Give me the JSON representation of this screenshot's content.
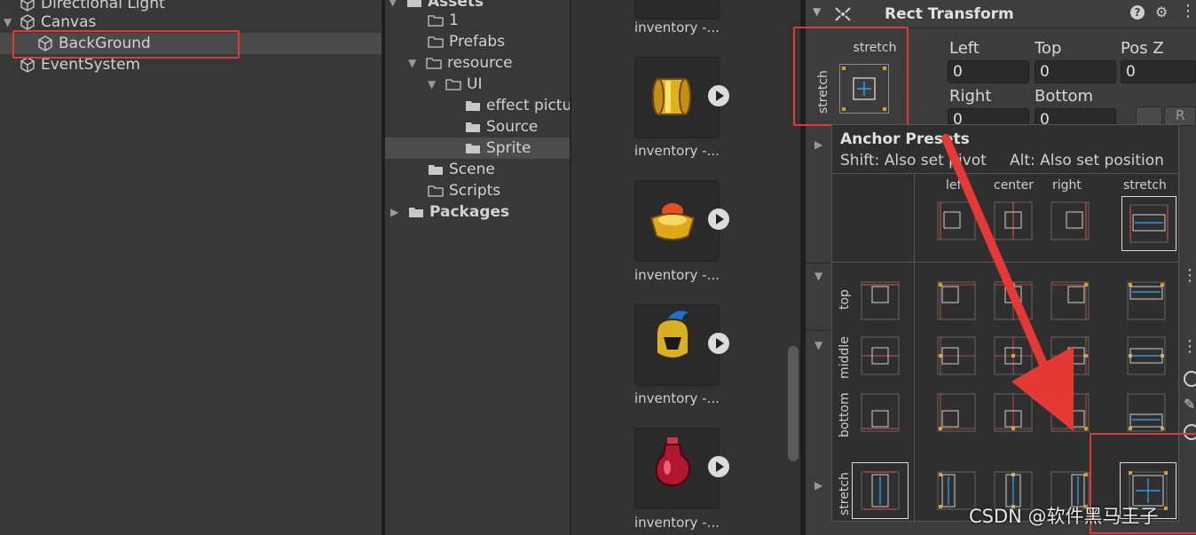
{
  "hierarchy": {
    "items": [
      {
        "label": "Directional Light",
        "expanded": false
      },
      {
        "label": "Canvas",
        "expanded": true
      },
      {
        "label": "BackGround",
        "selected": true
      },
      {
        "label": "EventSystem"
      }
    ]
  },
  "project": {
    "items": [
      {
        "label": "Assets",
        "bold": true
      },
      {
        "label": "1"
      },
      {
        "label": "Prefabs"
      },
      {
        "label": "resource"
      },
      {
        "label": "UI"
      },
      {
        "label": "effect pictu"
      },
      {
        "label": "Source"
      },
      {
        "label": "Sprite",
        "selected": true
      },
      {
        "label": "Scene"
      },
      {
        "label": "Scripts"
      },
      {
        "label": "Packages",
        "bold": true
      }
    ]
  },
  "assets": {
    "label": "inventory -..."
  },
  "inspector": {
    "component_title": "Rect Transform",
    "anchor_horizontal": "stretch",
    "anchor_vertical": "stretch",
    "fields": {
      "left_label": "Left",
      "left_value": "0",
      "top_label": "Top",
      "top_value": "0",
      "posz_label": "Pos Z",
      "posz_value": "0",
      "right_label": "Right",
      "right_value": "0",
      "bottom_label": "Bottom",
      "bottom_value": "0"
    },
    "r_button": "R"
  },
  "popup": {
    "title": "Anchor Presets",
    "shift_hint": "Shift: Also set pivot",
    "alt_hint": "Alt: Also set position",
    "columns": [
      "left",
      "center",
      "right",
      "stretch"
    ],
    "rows": [
      "top",
      "middle",
      "bottom",
      "stretch"
    ]
  },
  "watermark": "CSDN @软件黑马王子",
  "colors": {
    "accent_red": "#e53935",
    "anchor_blue": "#2e9be0",
    "anchor_yellow": "#d4a12a"
  }
}
